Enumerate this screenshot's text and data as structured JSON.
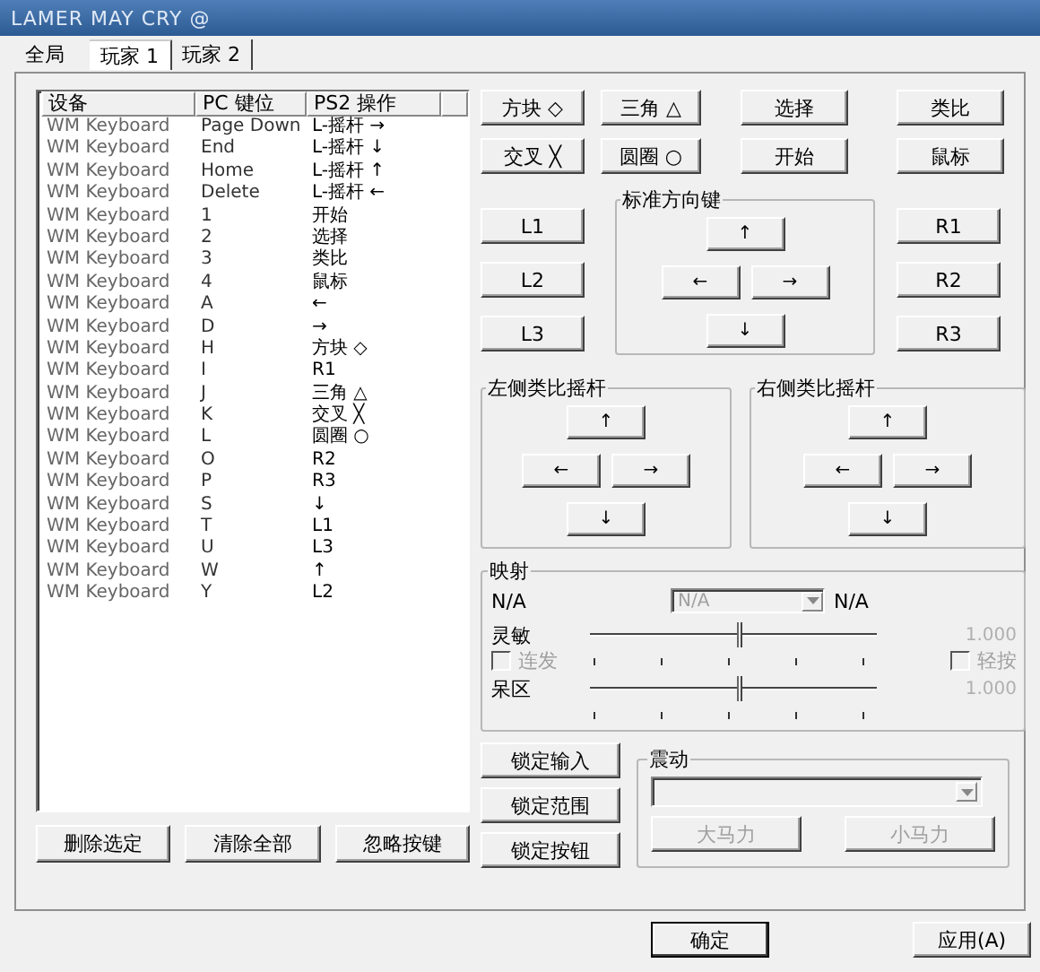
{
  "window": {
    "title": "LAMER MAY CRY @"
  },
  "tabs": [
    {
      "label": "全局",
      "selected": false
    },
    {
      "label": "玩家 1",
      "selected": true
    },
    {
      "label": "玩家 2",
      "selected": false
    }
  ],
  "table": {
    "columns": [
      "设备",
      "PC 键位",
      "PS2 操作"
    ],
    "rows": [
      [
        "WM Keyboard",
        "Page Down",
        "L-摇杆 →"
      ],
      [
        "WM Keyboard",
        "End",
        "L-摇杆 ↓"
      ],
      [
        "WM Keyboard",
        "Home",
        "L-摇杆 ↑"
      ],
      [
        "WM Keyboard",
        "Delete",
        "L-摇杆 ←"
      ],
      [
        "WM Keyboard",
        "1",
        "开始"
      ],
      [
        "WM Keyboard",
        "2",
        "选择"
      ],
      [
        "WM Keyboard",
        "3",
        "类比"
      ],
      [
        "WM Keyboard",
        "4",
        "鼠标"
      ],
      [
        "WM Keyboard",
        "A",
        "←"
      ],
      [
        "WM Keyboard",
        "D",
        "→"
      ],
      [
        "WM Keyboard",
        "H",
        "方块 ◇"
      ],
      [
        "WM Keyboard",
        "I",
        "R1"
      ],
      [
        "WM Keyboard",
        "J",
        "三角 △"
      ],
      [
        "WM Keyboard",
        "K",
        "交叉 ╳"
      ],
      [
        "WM Keyboard",
        "L",
        "圆圈 ○"
      ],
      [
        "WM Keyboard",
        "O",
        "R2"
      ],
      [
        "WM Keyboard",
        "P",
        "R3"
      ],
      [
        "WM Keyboard",
        "S",
        "↓"
      ],
      [
        "WM Keyboard",
        "T",
        "L1"
      ],
      [
        "WM Keyboard",
        "U",
        "L3"
      ],
      [
        "WM Keyboard",
        "W",
        "↑"
      ],
      [
        "WM Keyboard",
        "Y",
        "L2"
      ]
    ]
  },
  "list_buttons": [
    "删除选定",
    "清除全部",
    "忽略按键"
  ],
  "face_buttons": [
    "方块 ◇",
    "三角 △",
    "选择",
    "类比",
    "交叉 ╳",
    "圆圈 ○",
    "开始",
    "鼠标"
  ],
  "left_shoulder": [
    "L1",
    "L2",
    "L3"
  ],
  "right_shoulder": [
    "R1",
    "R2",
    "R3"
  ],
  "dpad": {
    "title": "标准方向键",
    "up": "↑",
    "left": "←",
    "right": "→",
    "down": "↓"
  },
  "left_stick": {
    "title": "左侧类比摇杆",
    "up": "↑",
    "left": "←",
    "right": "→",
    "down": "↓"
  },
  "right_stick": {
    "title": "右侧类比摇杆",
    "up": "↑",
    "left": "←",
    "right": "→",
    "down": "↓"
  },
  "mapping": {
    "title": "映射",
    "label": "N/A",
    "combo": {
      "value": "N/A",
      "disabled": true
    },
    "reading": "N/A",
    "sliders": [
      {
        "label": "灵敏",
        "level": 0.52,
        "reading": "1.000"
      },
      {
        "label": "呆区",
        "level": 0.52,
        "reading": "1.000"
      }
    ],
    "checkboxes": [
      {
        "label": "连发",
        "checked": false,
        "disabled": true
      },
      {
        "label": "轻按",
        "checked": false,
        "disabled": true
      }
    ]
  },
  "lock_buttons": [
    "锁定输入",
    "锁定范围",
    "锁定按钮"
  ],
  "vibration": {
    "title": "震动",
    "buttons": [
      {
        "label": "大马力",
        "disabled": true
      },
      {
        "label": "小马力",
        "disabled": true
      }
    ]
  },
  "dialog_buttons": [
    "确定",
    "应用(A)"
  ]
}
